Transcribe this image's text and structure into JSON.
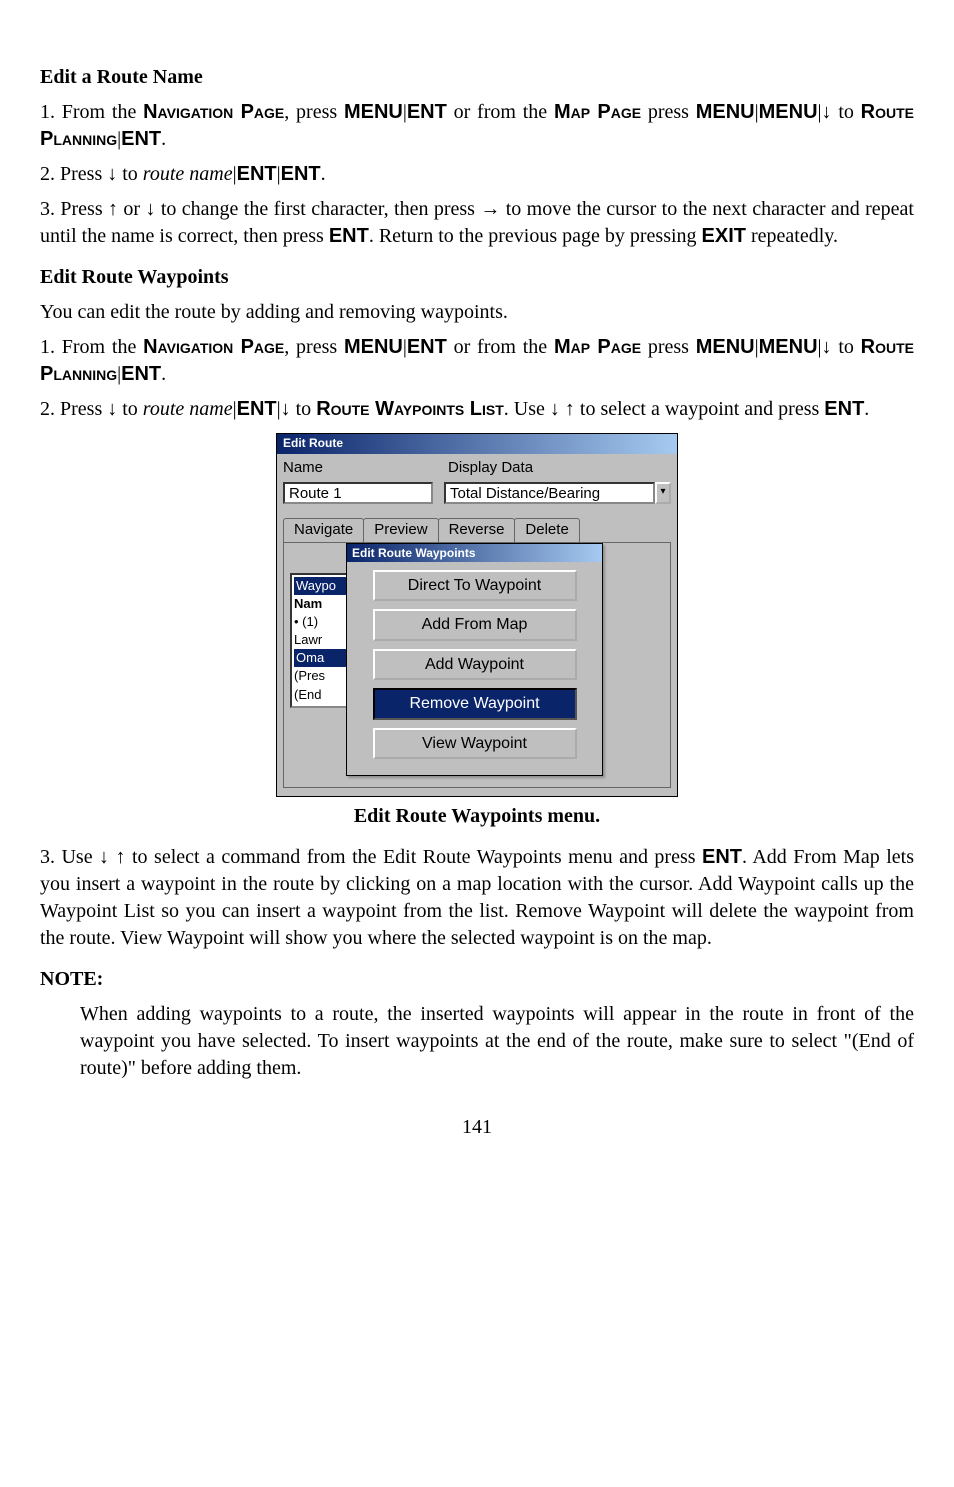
{
  "section1_title": "Edit a Route Name",
  "p1_a": "1. From the ",
  "p1_b": "Navigation Page",
  "p1_c": ", press ",
  "p1_d": "MENU",
  "p1_e": "ENT",
  "p1_f": " or from the ",
  "p1_g": "Map Page",
  "p1_h": " press ",
  "p1_i": "MENU",
  "p1_j": "MENU",
  "p1_k": " to ",
  "p1_l": "Route Planning",
  "p1_m": "ENT",
  "p2_a": "2. Press ",
  "p2_b": " to ",
  "p2_c": "route name",
  "p2_d": "ENT",
  "p2_e": "ENT",
  "p3_a": "3. Press ",
  "p3_b": " or ",
  "p3_c": " to change the first character, then press ",
  "p3_d": " to move the cursor to the next character and repeat until the name is correct, then press ",
  "p3_e": "ENT",
  "p3_f": ". Return to the previous page by pressing ",
  "p3_g": "EXIT",
  "p3_h": " repeatedly.",
  "section2_title": "Edit Route Waypoints",
  "p4": "You can edit the route by adding and removing waypoints.",
  "p5_a": "1. From the ",
  "p5_b": "Navigation Page",
  "p5_c": ", press ",
  "p5_d": "MENU",
  "p5_e": "ENT",
  "p5_f": " or from the ",
  "p5_g": "Map Page",
  "p5_h": " press ",
  "p5_i": "MENU",
  "p5_j": "MENU",
  "p5_k": " to ",
  "p5_l": "Route Planning",
  "p5_m": "ENT",
  "p6_a": "2. Press ",
  "p6_b": " to ",
  "p6_c": "route name",
  "p6_d": "ENT",
  "p6_e": " to ",
  "p6_f": "Route Waypoints List",
  "p6_g": ". Use ",
  "p6_h": " to select a waypoint and press ",
  "p6_i": "ENT",
  "shot": {
    "window_title": "Edit Route",
    "name_label": "Name",
    "display_label": "Display Data",
    "name_value": "Route 1",
    "display_value": "Total Distance/Bearing",
    "tabs": [
      "Navigate",
      "Preview",
      "Reverse",
      "Delete"
    ],
    "back_list": {
      "waypo": "Waypo",
      "name": "Nam",
      "row1": "(1)",
      "row2": "Lawr",
      "row3": "Oma",
      "row4": "(Pres",
      "row5": "(End"
    },
    "dialog_title": "Edit Route Waypoints",
    "dialog_buttons": [
      "Direct To Waypoint",
      "Add From Map",
      "Add Waypoint",
      "Remove Waypoint",
      "View Waypoint"
    ],
    "dialog_selected_index": 3
  },
  "caption": "Edit Route Waypoints menu.",
  "p7_a": "3. Use ",
  "p7_b": " to select a command from the Edit Route Waypoints menu and press ",
  "p7_c": "ENT",
  "p7_d": ". Add From Map lets you insert a waypoint in the route by clicking on a map location with the cursor. Add Waypoint calls up the Waypoint List so you can insert a waypoint from the list. Remove Waypoint will delete the waypoint from the route. View Waypoint will show you where the selected waypoint is on the map.",
  "note_heading": "NOTE:",
  "note_body": "When adding waypoints to a route, the inserted waypoints will appear in the route in front of the waypoint you have selected. To insert waypoints at the end of the route, make sure to select \"(End of route)\" before adding them.",
  "page_number": "141",
  "glyph_down": "↓",
  "glyph_up": "↑",
  "glyph_right": "→",
  "glyph_pipe": "|",
  "period": "."
}
